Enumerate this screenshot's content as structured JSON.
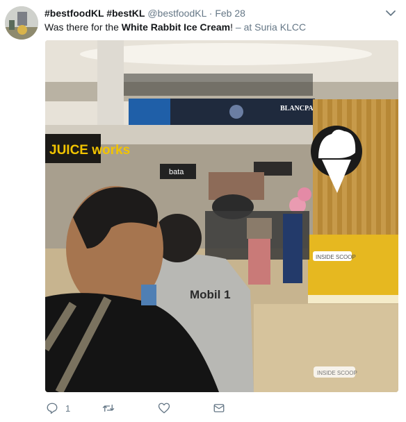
{
  "tweet": {
    "display_name": "#bestfoodKL #bestKL",
    "handle": "@bestfoodKL",
    "separator": "·",
    "date": "Feb 28",
    "text_before": "Was there for the ",
    "text_bold": "White Rabbit Ice Cream",
    "text_after": "! ",
    "location": "– at Suria KLCC"
  },
  "photo": {
    "signs": {
      "juice_works": "JUICE works",
      "blancpain": "BLANCPAIN",
      "bata": "bata",
      "inside_scoop_1": "INSIDE SCOOP",
      "inside_scoop_2": "INSIDE SCOOP",
      "mobil_shirt": "Mobil 1",
      "inside_scoop_small": "INSIDE SCOOP"
    }
  },
  "actions": {
    "reply_count": "1",
    "retweet_count": "",
    "like_count": ""
  },
  "colors": {
    "text": "#14171a",
    "secondary": "#657786",
    "kiosk_yellow": "#e6b820"
  },
  "icons": [
    "avatar",
    "chevron-down-icon",
    "reply-icon",
    "retweet-icon",
    "like-icon",
    "message-icon"
  ]
}
